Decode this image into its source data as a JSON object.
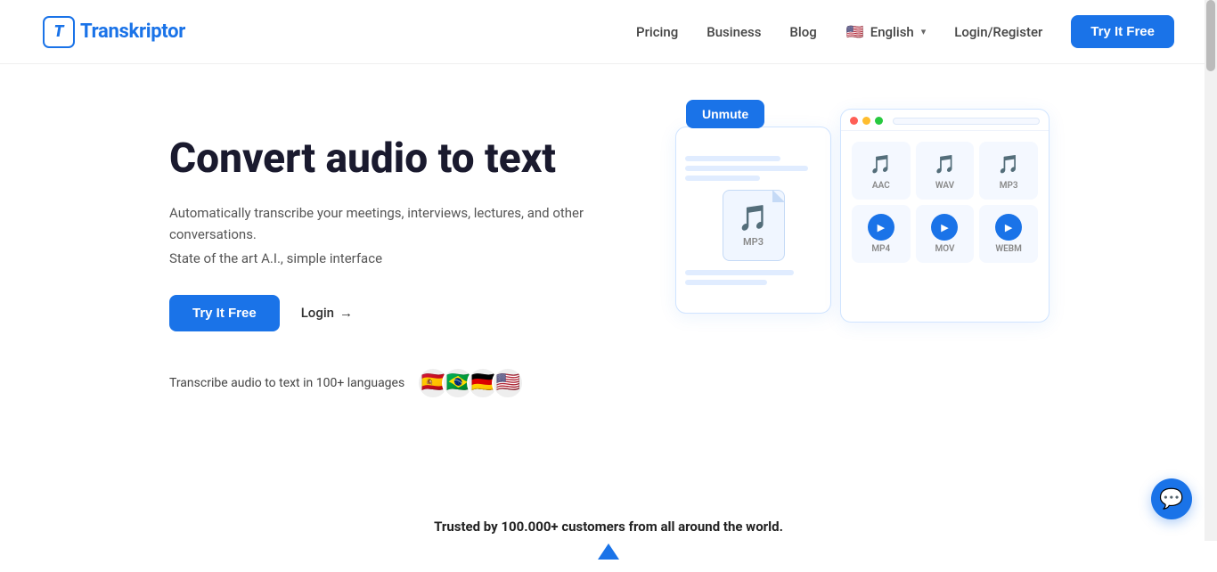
{
  "header": {
    "logo_icon": "T",
    "logo_name": "Transkriptor",
    "nav": {
      "pricing": "Pricing",
      "business": "Business",
      "blog": "Blog",
      "language": "English",
      "login_register": "Login/Register",
      "try_free": "Try It Free"
    }
  },
  "hero": {
    "title": "Convert audio to text",
    "description1": "Automatically transcribe your meetings, interviews, lectures, and other conversations.",
    "description2": "State of the art A.I., simple interface",
    "try_btn": "Try It Free",
    "login_text": "Login",
    "login_arrow": "→",
    "lang_label": "Transcribe audio to text in 100+ languages",
    "flags": [
      "🇪🇸",
      "🇧🇷",
      "🇩🇪",
      "🇺🇸"
    ]
  },
  "illustration": {
    "unmute_btn": "Unmute",
    "mp3_label": "MP3",
    "formats": [
      {
        "label": "AAC",
        "type": "audio"
      },
      {
        "label": "WAV",
        "type": "audio"
      },
      {
        "label": "MP3",
        "type": "audio"
      },
      {
        "label": "MP4",
        "type": "video"
      },
      {
        "label": "MOV",
        "type": "video"
      },
      {
        "label": "WEBM",
        "type": "video"
      }
    ]
  },
  "trusted": {
    "text": "Trusted by 100.000+ customers from all around the world."
  }
}
